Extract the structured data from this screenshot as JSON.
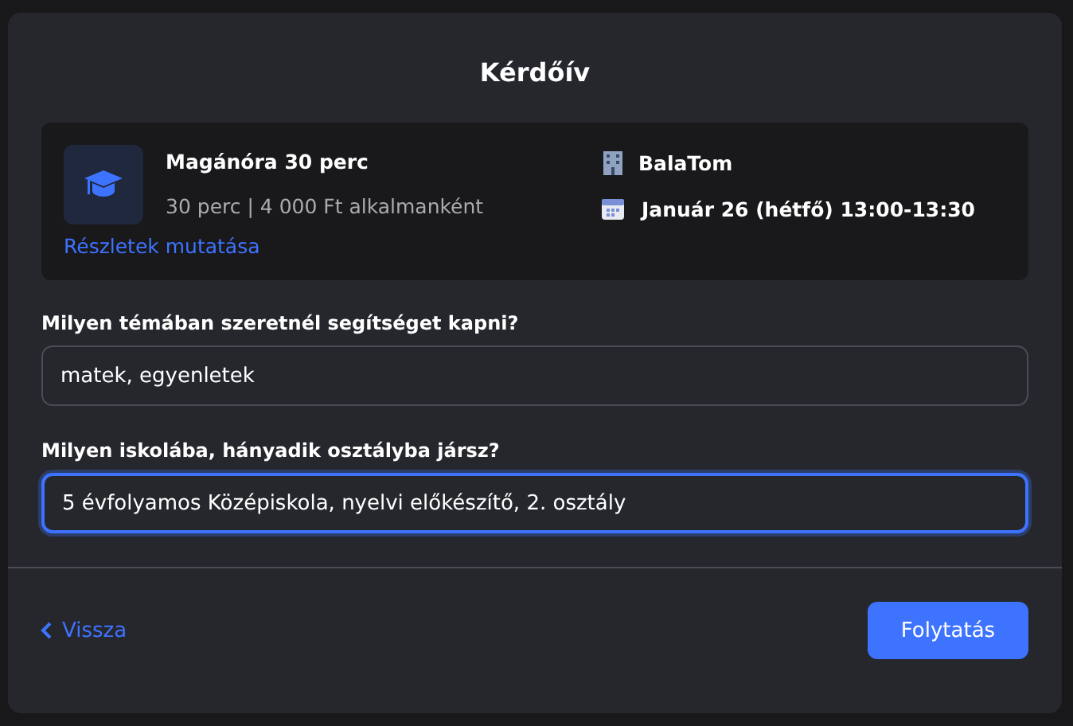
{
  "dialog": {
    "title": "Kérdőív"
  },
  "booking": {
    "service": "Magánóra 30 perc",
    "details": "30 perc | 4 000 Ft alkalmanként",
    "details_link": "Részletek mutatása",
    "location": "BalaTom",
    "date": "Január 26 (hétfő) 13:00-13:30"
  },
  "fields": [
    {
      "label": "Milyen témában szeretnél segítséget kapni?",
      "value": "matek, egyenletek",
      "focused": false
    },
    {
      "label": "Milyen iskolába, hányadik osztályba jársz?",
      "value": "5 évfolyamos Középiskola, nyelvi előkészítő, 2. osztály",
      "focused": true
    }
  ],
  "footer": {
    "back": "Vissza",
    "next": "Folytatás"
  }
}
